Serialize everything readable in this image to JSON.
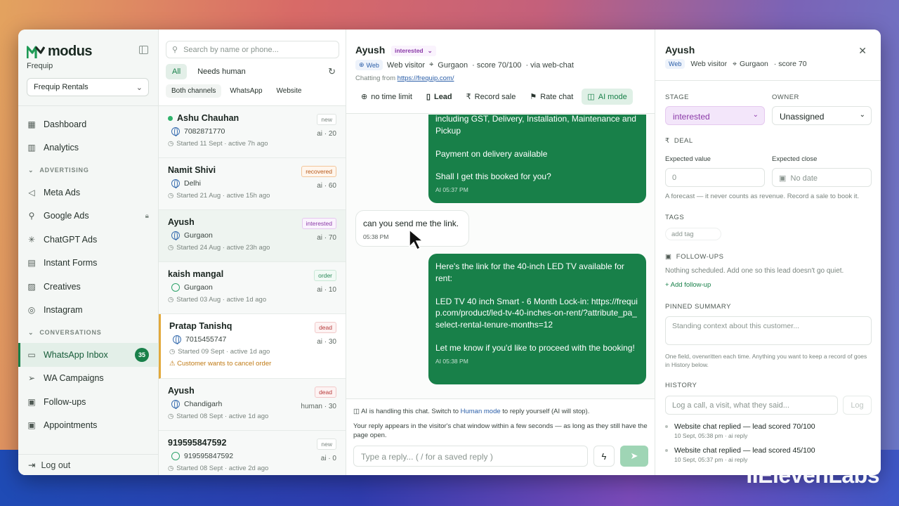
{
  "app": {
    "brand": "modus",
    "org": "Frequip",
    "workspace": "Frequip Rentals",
    "accent": "#188049"
  },
  "sidebar": {
    "items": [
      {
        "label": "Dashboard",
        "icon": "grid-icon"
      },
      {
        "label": "Analytics",
        "icon": "chart-icon"
      }
    ],
    "section_advertising": "ADVERTISING",
    "ad_items": [
      {
        "label": "Meta Ads",
        "icon": "megaphone-icon"
      },
      {
        "label": "Google Ads",
        "icon": "search-icon"
      },
      {
        "label": "ChatGPT Ads",
        "icon": "sparkle-icon"
      },
      {
        "label": "Instant Forms",
        "icon": "clipboard-icon"
      },
      {
        "label": "Creatives",
        "icon": "image-icon"
      },
      {
        "label": "Instagram",
        "icon": "instagram-icon"
      }
    ],
    "section_conversations": "CONVERSATIONS",
    "conv_items": [
      {
        "label": "WhatsApp Inbox",
        "icon": "chat-icon",
        "badge": "35"
      },
      {
        "label": "WA Campaigns",
        "icon": "send-icon"
      },
      {
        "label": "Follow-ups",
        "icon": "calendar-icon"
      },
      {
        "label": "Appointments",
        "icon": "calendar-icon"
      }
    ],
    "logout": "Log out"
  },
  "list": {
    "search_placeholder": "Search by name or phone...",
    "filter_all": "All",
    "filter_needs_human": "Needs human",
    "channel_both": "Both channels",
    "channel_whatsapp": "WhatsApp",
    "channel_website": "Website",
    "cards": [
      {
        "name": "Ashu Chauhan",
        "tag": "new",
        "sub": "7082871770",
        "ai": "ai · 20",
        "meta": "Started 11 Sept · active 7h ago"
      },
      {
        "name": "Namit Shivi",
        "tag": "recovered",
        "sub": "Delhi",
        "ai": "ai · 60",
        "meta": "Started 21 Aug · active 15h ago"
      },
      {
        "name": "Ayush",
        "tag": "interested",
        "sub": "Gurgaon",
        "ai": "ai · 70",
        "meta": "Started 24 Aug · active 23h ago"
      },
      {
        "name": "kaish mangal",
        "tag": "order",
        "sub": "Gurgaon",
        "ai": "ai · 10",
        "meta": "Started 03 Aug · active 1d ago"
      },
      {
        "name": "Pratap Tanishq",
        "tag": "dead",
        "sub": "7015455747",
        "ai": "ai · 30",
        "meta": "Started 09 Sept · active 1d ago",
        "warning": "Customer wants to cancel order"
      },
      {
        "name": "Ayush",
        "tag": "dead",
        "sub": "Chandigarh",
        "ai": "human · 30",
        "meta": "Started 08 Sept · active 1d ago"
      },
      {
        "name": "919595847592",
        "tag": "new",
        "sub": "919595847592",
        "ai": "ai · 0",
        "meta": "Started 08 Sept · active 2d ago"
      }
    ]
  },
  "chat": {
    "name": "Ayush",
    "stage": "interested",
    "channel": "Web",
    "visitor": "Web visitor",
    "city": "Gurgaon",
    "score": "· score 70/100",
    "via": "· via web-chat",
    "from_label": "Chatting from",
    "from_url": "https://frequip.com/",
    "tools": {
      "time": "no time limit",
      "lead": "Lead",
      "record": "Record sale",
      "rate": "Rate chat",
      "aimode": "AI mode"
    },
    "messages": [
      {
        "text1": "including GST, Delivery, Installation, Maintenance and Pickup",
        "text2": "Payment on delivery available",
        "text3": "Shall I get this booked for you?",
        "ts": "AI 05:37 PM"
      },
      {
        "text": "can you send me the link.",
        "ts": "05:38 PM"
      },
      {
        "text1": "Here's the link for the 40-inch LED TV available for rent:",
        "text2": "LED TV 40 inch Smart - 6 Month Lock-in: https://frequip.com/product/led-tv-40-inches-on-rent/?attribute_pa_select-rental-tenure-months=12",
        "text3": "Let me know if you'd like to proceed with the booking!",
        "ts": "AI 05:38 PM"
      }
    ],
    "footer_note_a": "AI is handling this chat. Switch to",
    "footer_note_link": "Human mode",
    "footer_note_b": "to reply yourself (AI will stop).",
    "footer_note2": "Your reply appears in the visitor's chat window within a few seconds — as long as they still have the page open.",
    "reply_placeholder": "Type a reply...    ( / for a saved reply )"
  },
  "panel": {
    "name": "Ayush",
    "channel": "Web",
    "visitor": "Web visitor",
    "city": "Gurgaon",
    "score": "· score 70",
    "stage_label": "STAGE",
    "stage_value": "interested",
    "owner_label": "OWNER",
    "owner_value": "Unassigned",
    "deal_label": "DEAL",
    "expected_value_label": "Expected value",
    "expected_value": "0",
    "expected_close_label": "Expected close",
    "expected_close": "No date",
    "forecast_note": "A forecast — it never counts as revenue. Record a sale to book it.",
    "tags_label": "TAGS",
    "add_tag": "add tag",
    "followups_label": "FOLLOW-UPS",
    "followups_note": "Nothing scheduled. Add one so this lead doesn't go quiet.",
    "add_followup": "+ Add follow-up",
    "pinned_label": "PINNED SUMMARY",
    "pinned_placeholder": "Standing context about this customer...",
    "pinned_note": "One field, overwritten each time. Anything you want to keep a record of goes in History below.",
    "history_label": "HISTORY",
    "history_placeholder": "Log a call, a visit, what they said...",
    "log_button": "Log",
    "history": [
      {
        "title": "Website chat replied — lead scored 70/100",
        "sub": "10 Sept, 05:38 pm · ai reply"
      },
      {
        "title": "Website chat replied — lead scored 45/100",
        "sub": "10 Sept, 05:37 pm · ai reply"
      }
    ]
  },
  "watermark": "IIElevenLabs"
}
